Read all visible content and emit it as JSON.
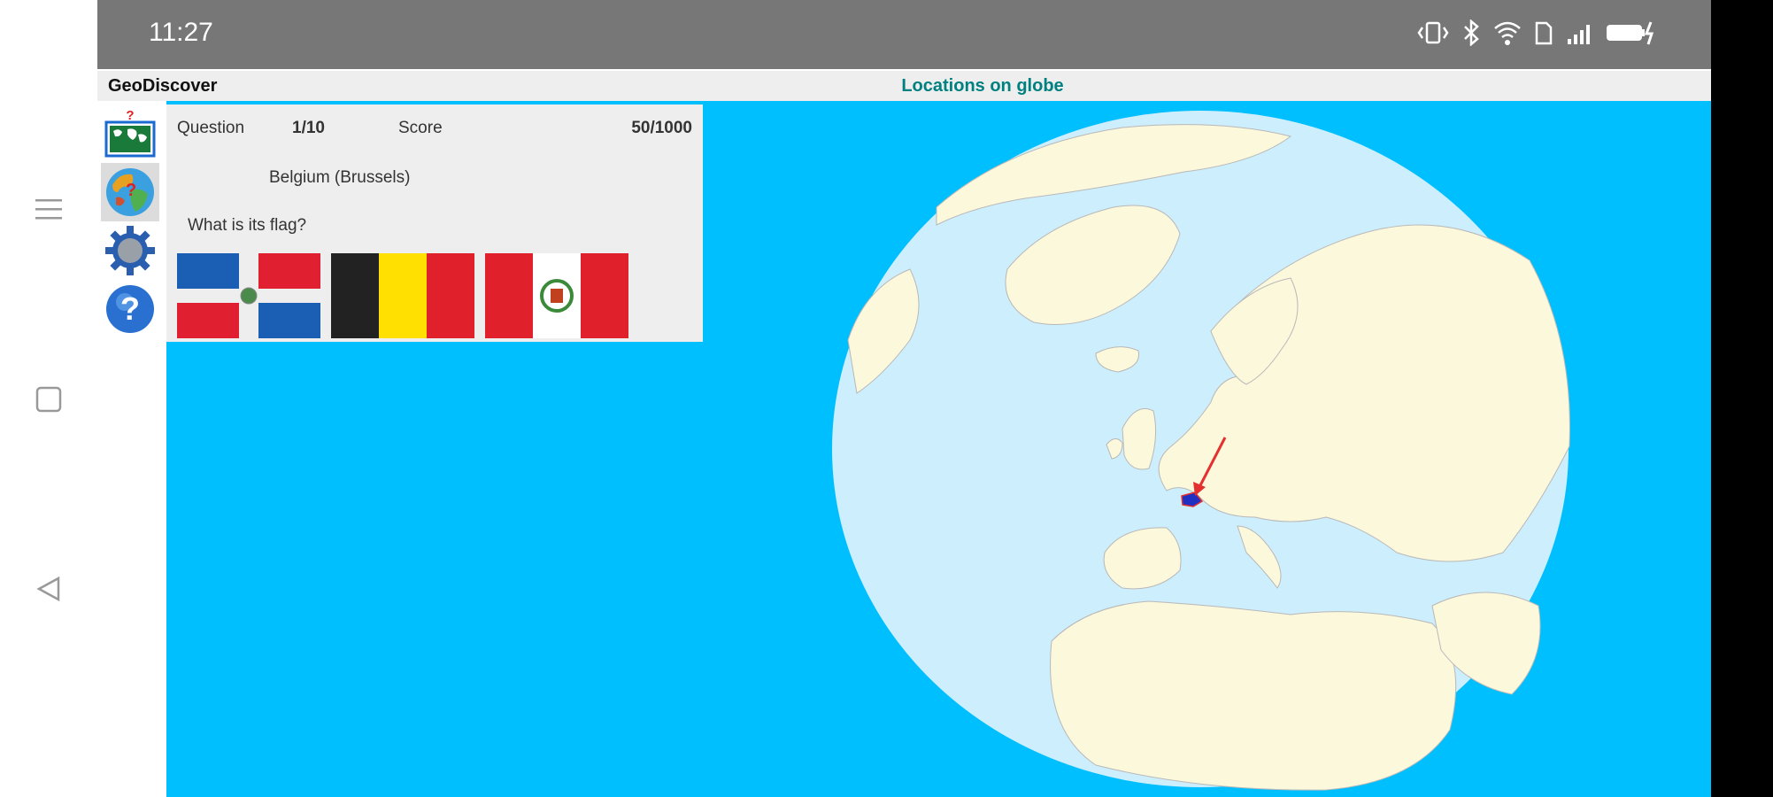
{
  "status": {
    "time": "11:27"
  },
  "app": {
    "name": "GeoDiscover",
    "title": "Locations on globe"
  },
  "quiz": {
    "question_label": "Question",
    "question_value": "1/10",
    "score_label": "Score",
    "score_value": "50/1000",
    "country": "Belgium (Brussels)",
    "prompt": "What is its flag?"
  },
  "flags": [
    {
      "country": "Dominican Republic",
      "icon": "dominican-republic-flag"
    },
    {
      "country": "Belgium",
      "icon": "belgium-flag"
    },
    {
      "country": "Peru",
      "icon": "peru-flag"
    }
  ],
  "tools": [
    "world-map-quiz-icon",
    "globe-quiz-icon",
    "settings-gear-icon",
    "help-icon"
  ],
  "colors": {
    "map_background": "#00bfff",
    "land": "#fcf8dc",
    "ocean_globe": "#cdeefc",
    "highlight": "#2030c0",
    "pointer": "#e53030",
    "title_accent": "#008080"
  }
}
